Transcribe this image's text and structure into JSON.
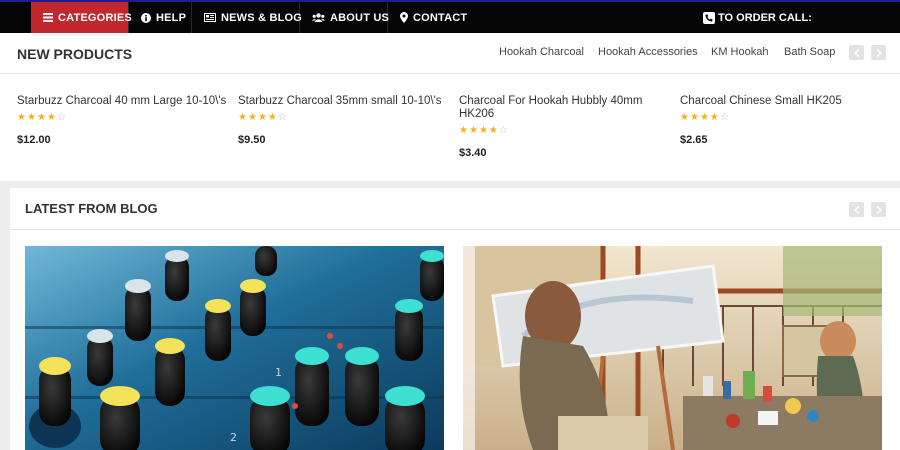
{
  "nav": {
    "items": [
      {
        "label": "CATEGORIES",
        "icon": "menu-icon"
      },
      {
        "label": "HELP",
        "icon": "info-icon"
      },
      {
        "label": "NEWS & BLOG",
        "icon": "newspaper-icon"
      },
      {
        "label": "ABOUT US",
        "icon": "users-icon"
      },
      {
        "label": "CONTACT",
        "icon": "map-marker-icon"
      }
    ],
    "order_call": "TO ORDER CALL:",
    "active_color": "#c1272d"
  },
  "new_products": {
    "title": "NEW PRODUCTS",
    "tabs": [
      "Hookah Charcoal",
      "Hookah Accessories",
      "KM Hookah",
      "Bath Soap"
    ],
    "products": [
      {
        "name": "Starbuzz Charcoal 40 mm Large 10-10\\'s",
        "rating": 4,
        "price": "$12.00"
      },
      {
        "name": "Starbuzz Charcoal 35mm small 10-10\\'s",
        "rating": 4,
        "price": "$9.50"
      },
      {
        "name": "Charcoal For Hookah Hubbly 40mm HK206",
        "rating": 4,
        "price": "$3.40"
      },
      {
        "name": "Charcoal Chinese Small HK205",
        "rating": 4,
        "price": "$2.65"
      }
    ]
  },
  "blog": {
    "title": "LATEST FROM BLOG",
    "posts": [
      {
        "image": "audio-mixer-knobs-photo"
      },
      {
        "image": "child-painting-on-balcony-photo"
      }
    ]
  }
}
